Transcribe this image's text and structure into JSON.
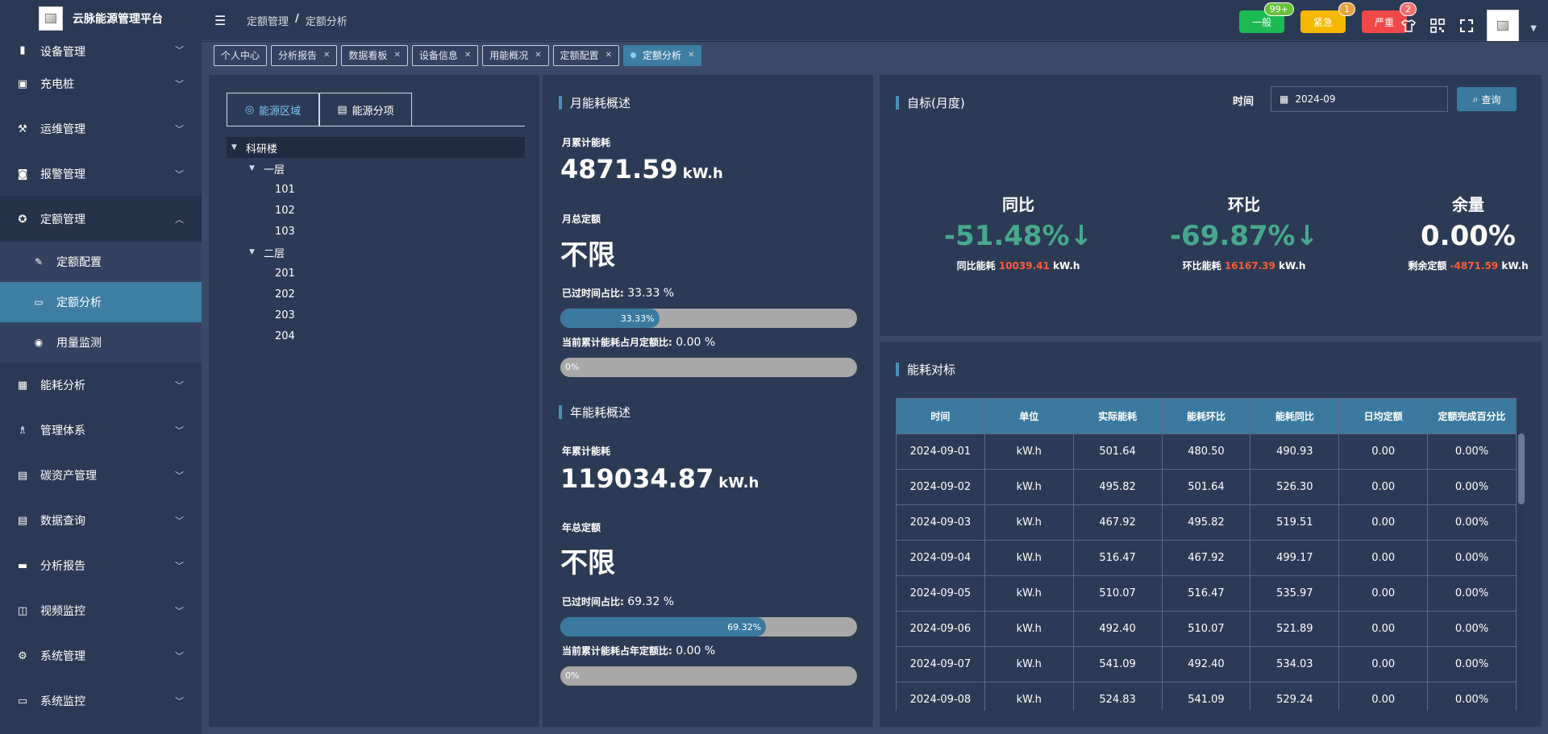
{
  "app": {
    "title": "云脉能源管理平台"
  },
  "sidebar": {
    "items": [
      {
        "label": "设备管理",
        "icon": "bar-chart-icon"
      },
      {
        "label": "充电桩",
        "icon": "charging-icon"
      },
      {
        "label": "运维管理",
        "icon": "wrench-icon"
      },
      {
        "label": "报警管理",
        "icon": "alarm-icon"
      },
      {
        "label": "定额管理",
        "icon": "quota-icon",
        "open": true,
        "children": [
          {
            "label": "定额配置",
            "icon": "config-icon"
          },
          {
            "label": "定额分析",
            "icon": "monitor-icon",
            "active": true
          },
          {
            "label": "用量监测",
            "icon": "signal-icon"
          }
        ]
      },
      {
        "label": "能耗分析",
        "icon": "grid-icon"
      },
      {
        "label": "管理体系",
        "icon": "hierarchy-icon"
      },
      {
        "label": "碳资产管理",
        "icon": "table-icon"
      },
      {
        "label": "数据查询",
        "icon": "table-icon"
      },
      {
        "label": "分析报告",
        "icon": "document-icon"
      },
      {
        "label": "视频监控",
        "icon": "camera-icon"
      },
      {
        "label": "系统管理",
        "icon": "gear-icon"
      },
      {
        "label": "系统监控",
        "icon": "monitor-icon"
      }
    ]
  },
  "header": {
    "breadcrumb": [
      "定额管理",
      "/",
      "定额分析"
    ],
    "alarms": [
      {
        "label": "一般",
        "badge": "99+",
        "color": "#1db954",
        "badge_color": "#67c23a"
      },
      {
        "label": "紧急",
        "badge": "1",
        "color": "#f5b800",
        "badge_color": "#e6a23c"
      },
      {
        "label": "严重",
        "badge": "2",
        "color": "#f04848",
        "badge_color": "#f56c6c"
      }
    ]
  },
  "tags": [
    {
      "label": "个人中心"
    },
    {
      "label": "分析报告"
    },
    {
      "label": "数据看板"
    },
    {
      "label": "设备信息"
    },
    {
      "label": "用能概况"
    },
    {
      "label": "定额配置"
    },
    {
      "label": "定额分析",
      "active": true
    }
  ],
  "tree_panel": {
    "tabs": [
      "能源区域",
      "能源分项"
    ],
    "root": "科研楼",
    "floors": [
      {
        "name": "一层",
        "rooms": [
          "101",
          "102",
          "103"
        ]
      },
      {
        "name": "二层",
        "rooms": [
          "201",
          "202",
          "203",
          "204"
        ]
      }
    ]
  },
  "energy_panel": {
    "month": {
      "title": "月能耗概述",
      "total_label": "月累计能耗",
      "total_value": "4871.59",
      "unit": "kW.h",
      "quota_label": "月总定额",
      "quota_value": "不限",
      "time_ratio_label": "已过时间占比:",
      "time_ratio_value": "33.33 %",
      "time_ratio_bar": "33.33%",
      "time_ratio_fraction": 0.3333,
      "quota_ratio_label": "当前累计能耗占月定额比:",
      "quota_ratio_value": "0.00 %",
      "quota_ratio_bar": "0%"
    },
    "year": {
      "title": "年能耗概述",
      "total_label": "年累计能耗",
      "total_value": "119034.87",
      "unit": "kW.h",
      "quota_label": "年总定额",
      "quota_value": "不限",
      "time_ratio_label": "已过时间占比:",
      "time_ratio_value": "69.32 %",
      "time_ratio_bar": "69.32%",
      "time_ratio_fraction": 0.6932,
      "quota_ratio_label": "当前累计能耗占年定额比:",
      "quota_ratio_value": "0.00 %",
      "quota_ratio_bar": "0%"
    }
  },
  "target_panel": {
    "title": "自标(月度)",
    "time_label": "时间",
    "time_value": "2024-09",
    "query_label": "查询",
    "stats": [
      {
        "title": "同比",
        "value": "-51.48%↓",
        "sub_label": "同比能耗",
        "sub_value": "10039.41",
        "sub_unit": "kW.h"
      },
      {
        "title": "环比",
        "value": "-69.87%↓",
        "sub_label": "环比能耗",
        "sub_value": "16167.39",
        "sub_unit": "kW.h"
      },
      {
        "title": "余量",
        "value": "0.00%",
        "sub_label": "剩余定额",
        "sub_value": "-4871.59",
        "sub_unit": "kW.h"
      }
    ]
  },
  "table_panel": {
    "title": "能耗对标",
    "columns": [
      "时间",
      "单位",
      "实际能耗",
      "能耗环比",
      "能耗同比",
      "日均定额",
      "定额完成百分比"
    ],
    "rows": [
      [
        "2024-09-01",
        "kW.h",
        "501.64",
        "480.50",
        "490.93",
        "0.00",
        "0.00%"
      ],
      [
        "2024-09-02",
        "kW.h",
        "495.82",
        "501.64",
        "526.30",
        "0.00",
        "0.00%"
      ],
      [
        "2024-09-03",
        "kW.h",
        "467.92",
        "495.82",
        "519.51",
        "0.00",
        "0.00%"
      ],
      [
        "2024-09-04",
        "kW.h",
        "516.47",
        "467.92",
        "499.17",
        "0.00",
        "0.00%"
      ],
      [
        "2024-09-05",
        "kW.h",
        "510.07",
        "516.47",
        "535.97",
        "0.00",
        "0.00%"
      ],
      [
        "2024-09-06",
        "kW.h",
        "492.40",
        "510.07",
        "521.89",
        "0.00",
        "0.00%"
      ],
      [
        "2024-09-07",
        "kW.h",
        "541.09",
        "492.40",
        "534.03",
        "0.00",
        "0.00%"
      ],
      [
        "2024-09-08",
        "kW.h",
        "524.83",
        "541.09",
        "529.24",
        "0.00",
        "0.00%"
      ]
    ]
  }
}
